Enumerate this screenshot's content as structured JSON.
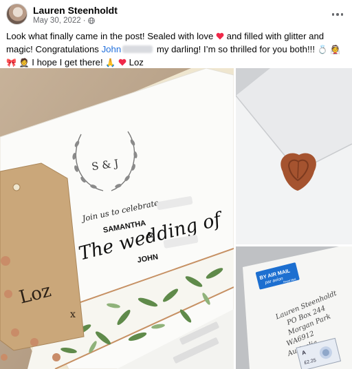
{
  "post": {
    "author": "Lauren Steenholdt",
    "date": "May 30, 2022",
    "date_separator": "·",
    "caption": {
      "part1": "Look what finally came in the post! Sealed with love",
      "part2": "and filled with glitter and magic! Congratulations",
      "mention": "John",
      "part3": "my darling! I’m so thrilled for you both!!!",
      "part4": "I hope I get there!",
      "part5": "Loz",
      "emoji_ring": "💍",
      "emoji_bride": "👰",
      "emoji_gift": "🎀",
      "emoji_groom": "🤵",
      "emoji_pray": "🙏"
    }
  },
  "photo_main": {
    "monogram": "S & J",
    "invite_line": "Join us to celebrate",
    "headline": "The wedding of",
    "name1": "SAMANTHA",
    "ampersand": "&",
    "name2": "JOHN",
    "tag_text": "Loz",
    "tag_x": "x"
  },
  "photo_bottom_right": {
    "airmail_line1": "BY AIR MAIL",
    "airmail_line2": "par avion",
    "airmail_line3": "Royal Mail",
    "address_line1": "Lauren Steenholdt",
    "address_line2": "PO Box 244",
    "address_line3": "Morgan Park",
    "address_line4": "WA6912",
    "address_line5": "Australia",
    "stamp_letter": "A",
    "stamp_value": "£2.25"
  },
  "icons": {
    "globe": "globe-icon",
    "more": "more-options-icon",
    "heart": "heart-icon"
  },
  "colors": {
    "mention": "#216fdb",
    "meta": "#65676b",
    "heart": "#f02849",
    "wax_seal": "#a5532f",
    "airmail_label": "#1d6fd0",
    "greenery": "#5f8a4a"
  }
}
